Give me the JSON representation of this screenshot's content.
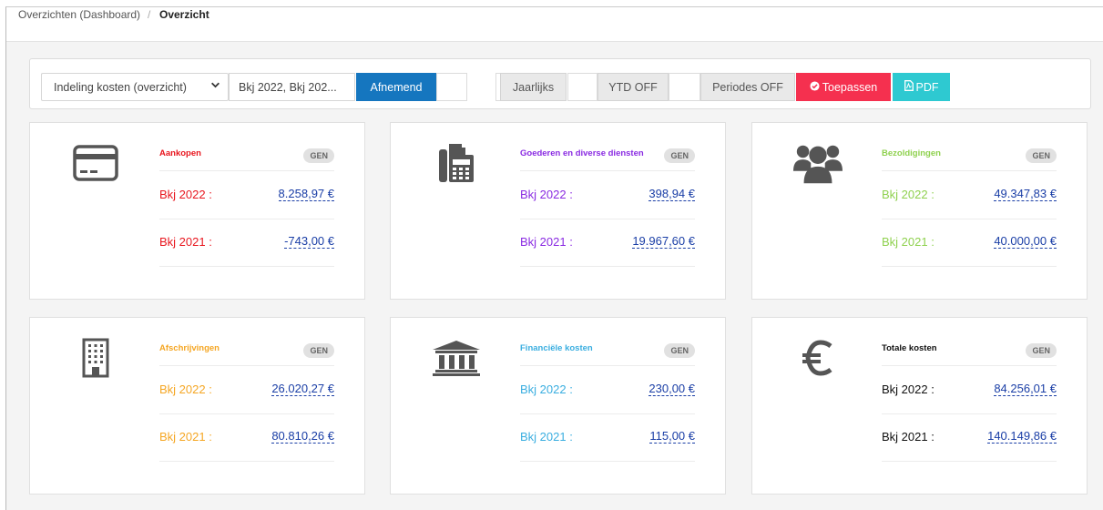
{
  "breadcrumb": {
    "parent": "Overzichten (Dashboard)",
    "separator": "/",
    "current": "Overzicht"
  },
  "toolbar": {
    "grouping_select": "Indeling kosten (overzicht)",
    "periods_select": "Bkj 2022, Bkj 202...",
    "sort_button": "Afnemend",
    "frequency_button": "Jaarlijks",
    "ytd_button": "YTD OFF",
    "periods_button": "Periodes OFF",
    "apply_button": "Toepassen",
    "pdf_button": "PDF"
  },
  "colors": {
    "red": "#e8161e",
    "purple": "#8a2be2",
    "lightgreen": "#8fd14f",
    "orange": "#f5a623",
    "blue": "#3aaee0",
    "black": "#111111",
    "icon": "#555555"
  },
  "cards": [
    {
      "title": "Aankopen",
      "badge": "GEN",
      "icon": "credit-card-icon",
      "color": "#e8161e",
      "rows": [
        {
          "label": "Bkj 2022 :",
          "value": "8.258,97 €"
        },
        {
          "label": "Bkj 2021 :",
          "value": "-743,00 €"
        }
      ]
    },
    {
      "title": "Goederen en diverse diensten",
      "badge": "GEN",
      "icon": "fax-icon",
      "color": "#8a2be2",
      "rows": [
        {
          "label": "Bkj 2022 :",
          "value": "398,94 €"
        },
        {
          "label": "Bkj 2021 :",
          "value": "19.967,60 €"
        }
      ]
    },
    {
      "title": "Bezoldigingen",
      "badge": "GEN",
      "icon": "users-icon",
      "color": "#8fd14f",
      "rows": [
        {
          "label": "Bkj 2022 :",
          "value": "49.347,83 €"
        },
        {
          "label": "Bkj 2021 :",
          "value": "40.000,00 €"
        }
      ]
    },
    {
      "title": "Afschrijvingen",
      "badge": "GEN",
      "icon": "building-icon",
      "color": "#f5a623",
      "rows": [
        {
          "label": "Bkj 2022 :",
          "value": "26.020,27 €"
        },
        {
          "label": "Bkj 2021 :",
          "value": "80.810,26 €"
        }
      ]
    },
    {
      "title": "Financiële kosten",
      "badge": "GEN",
      "icon": "bank-icon",
      "color": "#3aaee0",
      "rows": [
        {
          "label": "Bkj 2022 :",
          "value": "230,00 €"
        },
        {
          "label": "Bkj 2021 :",
          "value": "115,00 €"
        }
      ]
    },
    {
      "title": "Totale kosten",
      "badge": "GEN",
      "icon": "euro-icon",
      "color": "#111111",
      "rows": [
        {
          "label": "Bkj 2022 :",
          "value": "84.256,01 €"
        },
        {
          "label": "Bkj 2021 :",
          "value": "140.149,86 €"
        }
      ]
    }
  ]
}
